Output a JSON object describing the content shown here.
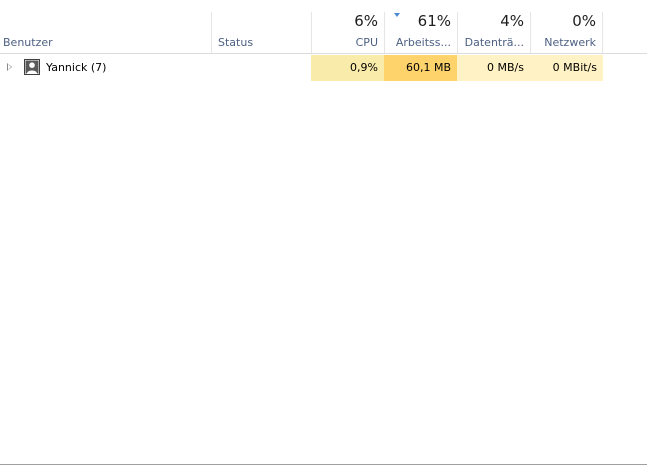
{
  "columns": {
    "benutzer": {
      "label": "Benutzer"
    },
    "status": {
      "label": "Status"
    },
    "cpu": {
      "percent": "6%",
      "label": "CPU"
    },
    "memory": {
      "percent": "61%",
      "label": "Arbeitss..."
    },
    "disk": {
      "percent": "4%",
      "label": "Datenträ..."
    },
    "network": {
      "percent": "0%",
      "label": "Netzwerk"
    }
  },
  "rows": [
    {
      "name": "Yannick (7)",
      "status": "",
      "cpu": "0,9%",
      "memory": "60,1 MB",
      "disk": "0 MB/s",
      "network": "0 MBit/s",
      "colors": {
        "cpu": "#f9ecab",
        "memory": "#ffd36c",
        "disk": "#fff2c4",
        "network": "#fff2c4"
      }
    }
  ],
  "colors": {
    "header_label": "#4d6082",
    "sort_arrow": "#4d8ad6"
  },
  "icons": {
    "expander": "chevron-right-icon",
    "avatar": "user-icon",
    "sort": "sort-descending-icon"
  }
}
